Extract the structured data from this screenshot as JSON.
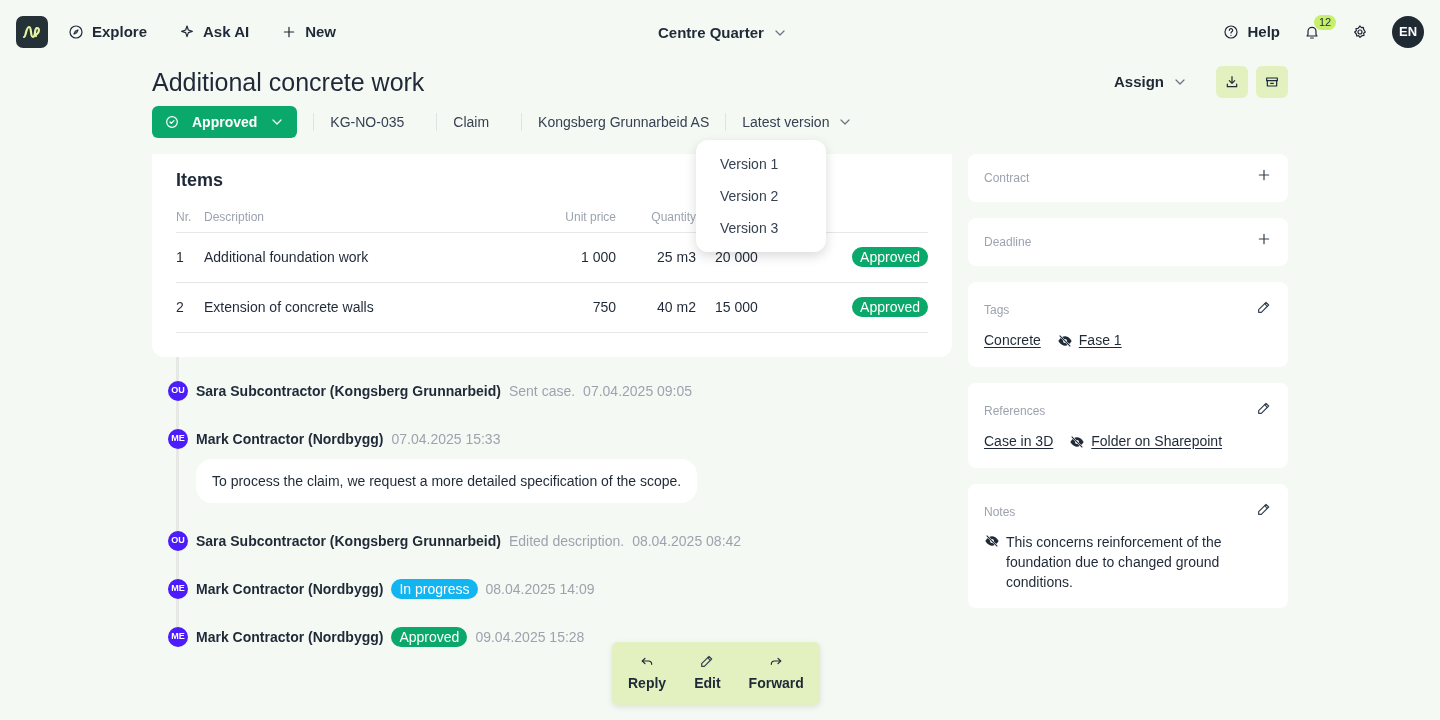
{
  "nav": {
    "items": [
      {
        "kind": "compass",
        "label": "Explore"
      },
      {
        "kind": "sparkle",
        "label": "Ask AI"
      },
      {
        "kind": "plus",
        "label": "New"
      }
    ],
    "project": "Centre Quarter",
    "help": "Help",
    "notifications": "12",
    "avatar": "EN"
  },
  "title": "Additional concrete work",
  "status": {
    "label": "Approved",
    "color": "#0aa86b"
  },
  "meta": [
    "KG-NO-035",
    "Claim",
    "Kongsberg Grunnarbeid AS"
  ],
  "version": {
    "label": "Latest version",
    "expanded": true,
    "options": [
      "Version 1",
      "Version 2",
      "Version 3"
    ]
  },
  "assign": "Assign",
  "items": {
    "title": "Items",
    "columns": [
      "Nr.",
      "Description",
      "Unit price",
      "Quantity"
    ],
    "rows": [
      {
        "nr": "1",
        "description": "Additional foundation work",
        "unit_price": "1 000",
        "quantity": "25 m3",
        "total": "20 000",
        "status": "Approved"
      },
      {
        "nr": "2",
        "description": "Extension of concrete walls",
        "unit_price": "750",
        "quantity": "40 m2",
        "total": "15 000",
        "status": "Approved"
      }
    ]
  },
  "timeline": [
    {
      "initials": "OU",
      "author": "Sara Subcontractor (Kongsberg Grunnarbeid)",
      "action": "Sent case.",
      "time": "07.04.2025 09:05"
    },
    {
      "initials": "ME",
      "author": "Mark Contractor (Nordbygg)",
      "time": "07.04.2025 15:33",
      "message": "To process the claim, we request a more detailed specification of the scope."
    },
    {
      "initials": "OU",
      "author": "Sara Subcontractor (Kongsberg Grunnarbeid)",
      "action": "Edited description.",
      "time": "08.04.2025 08:42"
    },
    {
      "initials": "ME",
      "author": "Mark Contractor (Nordbygg)",
      "badge": {
        "label": "In progress",
        "color": "#12b5f0"
      },
      "time": "08.04.2025 14:09"
    },
    {
      "initials": "ME",
      "author": "Mark Contractor (Nordbygg)",
      "badge": {
        "label": "Approved",
        "color": "#0aa86b"
      },
      "time": "09.04.2025 15:28"
    }
  ],
  "actions": [
    {
      "kind": "reply",
      "label": "Reply"
    },
    {
      "kind": "edit",
      "label": "Edit"
    },
    {
      "kind": "forward",
      "label": "Forward"
    }
  ],
  "side": [
    {
      "title": "Contract",
      "kind": "add"
    },
    {
      "title": "Deadline",
      "kind": "add"
    },
    {
      "title": "Tags",
      "kind": "links",
      "links": [
        {
          "label": "Concrete",
          "hidden": false
        },
        {
          "label": "Fase 1",
          "hidden": true
        }
      ]
    },
    {
      "title": "References",
      "kind": "links",
      "links": [
        {
          "label": "Case in 3D",
          "hidden": false
        },
        {
          "label": "Folder on Sharepoint",
          "hidden": true
        }
      ]
    },
    {
      "title": "Notes",
      "kind": "note",
      "hidden": true,
      "text": "This concerns reinforcement of the foundation due to changed ground conditions."
    }
  ]
}
